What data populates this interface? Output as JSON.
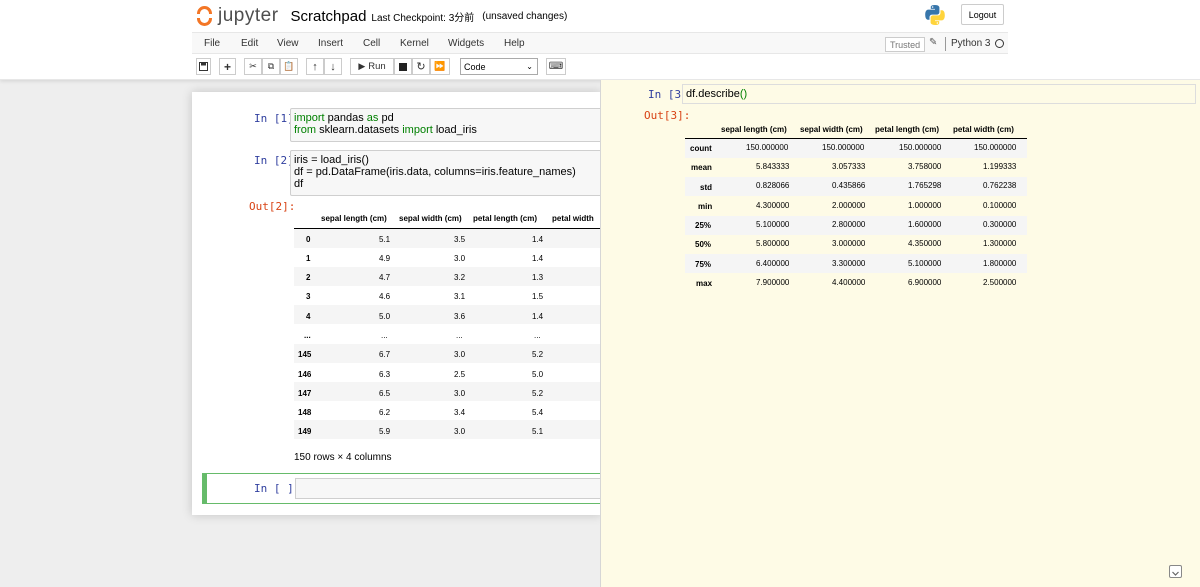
{
  "header": {
    "logo_text": "jupyter",
    "notebook_title": "Scratchpad",
    "checkpoint": "Last Checkpoint: 3分前",
    "save_status": "(unsaved changes)",
    "logout_label": "Logout"
  },
  "menu": {
    "items": [
      "File",
      "Edit",
      "View",
      "Insert",
      "Cell",
      "Kernel",
      "Widgets",
      "Help"
    ],
    "trusted": "Trusted",
    "kernel_name": "Python 3"
  },
  "toolbar": {
    "run_label": "Run",
    "cell_type": "Code"
  },
  "cells": {
    "in1_prompt": "In [1]:",
    "in1_line1_kw1": "import",
    "in1_line1_mod": "pandas",
    "in1_line1_kw2": "as",
    "in1_line1_alias": "pd",
    "in1_line2_kw1": "from",
    "in1_line2_mod": "sklearn.datasets",
    "in1_line2_kw2": "import",
    "in1_line2_name": "load_iris",
    "in2_prompt": "In [2]:",
    "in2_line1": "iris = load_iris()",
    "in2_line2": "df = pd.DataFrame(iris.data, columns=iris.feature_names)",
    "in2_line3": "df",
    "out2_prompt": "Out[2]:",
    "footer": "150 rows × 4 columns",
    "empty_prompt": "In [ ]:"
  },
  "df_preview": {
    "columns": [
      "sepal length (cm)",
      "sepal width (cm)",
      "petal length (cm)",
      "petal width"
    ],
    "rows": [
      {
        "idx": "0",
        "v": [
          "5.1",
          "3.5",
          "1.4"
        ]
      },
      {
        "idx": "1",
        "v": [
          "4.9",
          "3.0",
          "1.4"
        ]
      },
      {
        "idx": "2",
        "v": [
          "4.7",
          "3.2",
          "1.3"
        ]
      },
      {
        "idx": "3",
        "v": [
          "4.6",
          "3.1",
          "1.5"
        ]
      },
      {
        "idx": "4",
        "v": [
          "5.0",
          "3.6",
          "1.4"
        ]
      },
      {
        "idx": "...",
        "v": [
          "...",
          "...",
          "..."
        ]
      },
      {
        "idx": "145",
        "v": [
          "6.7",
          "3.0",
          "5.2"
        ]
      },
      {
        "idx": "146",
        "v": [
          "6.3",
          "2.5",
          "5.0"
        ]
      },
      {
        "idx": "147",
        "v": [
          "6.5",
          "3.0",
          "5.2"
        ]
      },
      {
        "idx": "148",
        "v": [
          "6.2",
          "3.4",
          "5.4"
        ]
      },
      {
        "idx": "149",
        "v": [
          "5.9",
          "3.0",
          "5.1"
        ]
      }
    ]
  },
  "scratch": {
    "in_prompt": "In [3]:",
    "code_text": "df.describe",
    "code_parens": "()",
    "out_prompt": "Out[3]:",
    "columns": [
      "sepal length (cm)",
      "sepal width (cm)",
      "petal length (cm)",
      "petal width (cm)"
    ],
    "rows": [
      {
        "idx": "count",
        "v": [
          "150.000000",
          "150.000000",
          "150.000000",
          "150.000000"
        ]
      },
      {
        "idx": "mean",
        "v": [
          "5.843333",
          "3.057333",
          "3.758000",
          "1.199333"
        ]
      },
      {
        "idx": "std",
        "v": [
          "0.828066",
          "0.435866",
          "1.765298",
          "0.762238"
        ]
      },
      {
        "idx": "min",
        "v": [
          "4.300000",
          "2.000000",
          "1.000000",
          "0.100000"
        ]
      },
      {
        "idx": "25%",
        "v": [
          "5.100000",
          "2.800000",
          "1.600000",
          "0.300000"
        ]
      },
      {
        "idx": "50%",
        "v": [
          "5.800000",
          "3.000000",
          "4.350000",
          "1.300000"
        ]
      },
      {
        "idx": "75%",
        "v": [
          "6.400000",
          "3.300000",
          "5.100000",
          "1.800000"
        ]
      },
      {
        "idx": "max",
        "v": [
          "7.900000",
          "4.400000",
          "6.900000",
          "2.500000"
        ]
      }
    ]
  }
}
